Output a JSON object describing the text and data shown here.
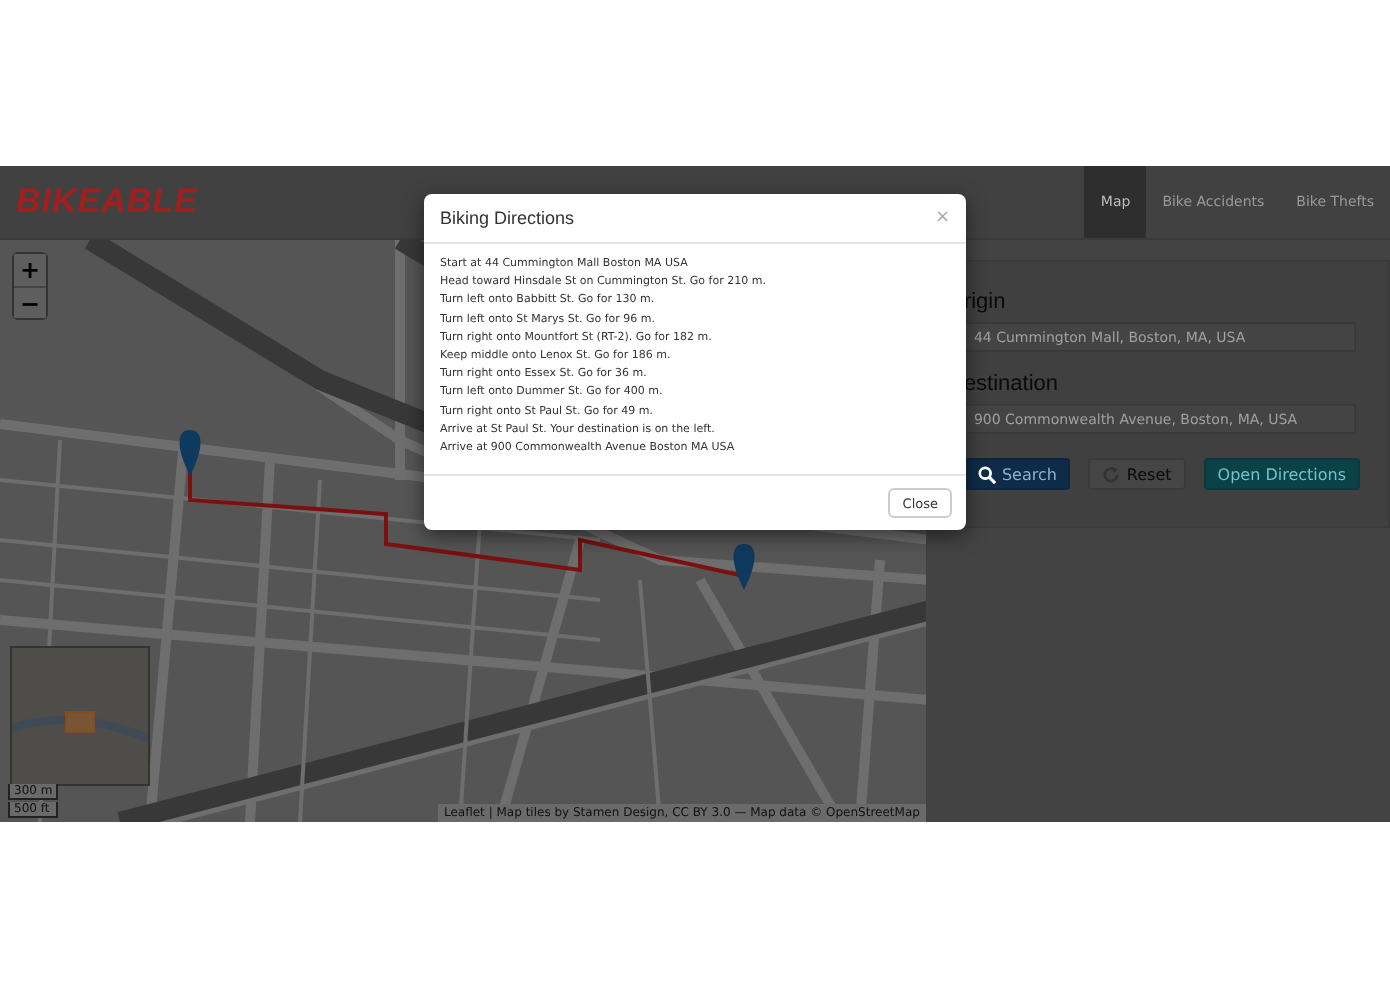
{
  "navbar": {
    "logo": "BIKEABLE",
    "tabs": [
      {
        "label": "Map",
        "selected": true
      },
      {
        "label": "Bike Accidents",
        "selected": false
      },
      {
        "label": "Bike Thefts",
        "selected": false
      }
    ]
  },
  "map": {
    "zoom_in": "+",
    "zoom_out": "−",
    "scale": [
      "300 m",
      "500 ft"
    ],
    "attribution": "Leaflet | Map tiles by Stamen Design, CC BY 3.0 — Map data © OpenStreetMap"
  },
  "panel": {
    "fields": [
      {
        "label": "rigin",
        "value": "44 Cummington Mall, Boston, MA, USA"
      },
      {
        "label": "estination",
        "value": "900 Commonwealth Avenue, Boston, MA, USA"
      }
    ],
    "buttons": [
      {
        "kind": "search",
        "label": "Search"
      },
      {
        "kind": "reset",
        "label": "Reset"
      },
      {
        "kind": "directions",
        "label": "Open Directions"
      }
    ]
  },
  "modal": {
    "title": "Biking Directions",
    "close_glyph": "×",
    "lines": [
      "Start at 44 Cummington Mall Boston MA USA",
      "Head toward Hinsdale St on Cummington St. Go for 210 m.",
      "Turn left onto Babbitt St. Go for 130 m.",
      "Turn left onto St Marys St. Go for 96 m.",
      "Turn right onto Mountfort St (RT-2). Go for 182 m.",
      "Keep middle onto Lenox St. Go for 186 m.",
      "Turn right onto Essex St. Go for 36 m.",
      "Turn left onto Dummer St. Go for 400 m.",
      "Turn right onto St Paul St. Go for 49 m.",
      "Arrive at St Paul St. Your destination is on the left.",
      "Arrive at 900 Commonwealth Avenue Boston MA USA"
    ],
    "button": "Close"
  }
}
